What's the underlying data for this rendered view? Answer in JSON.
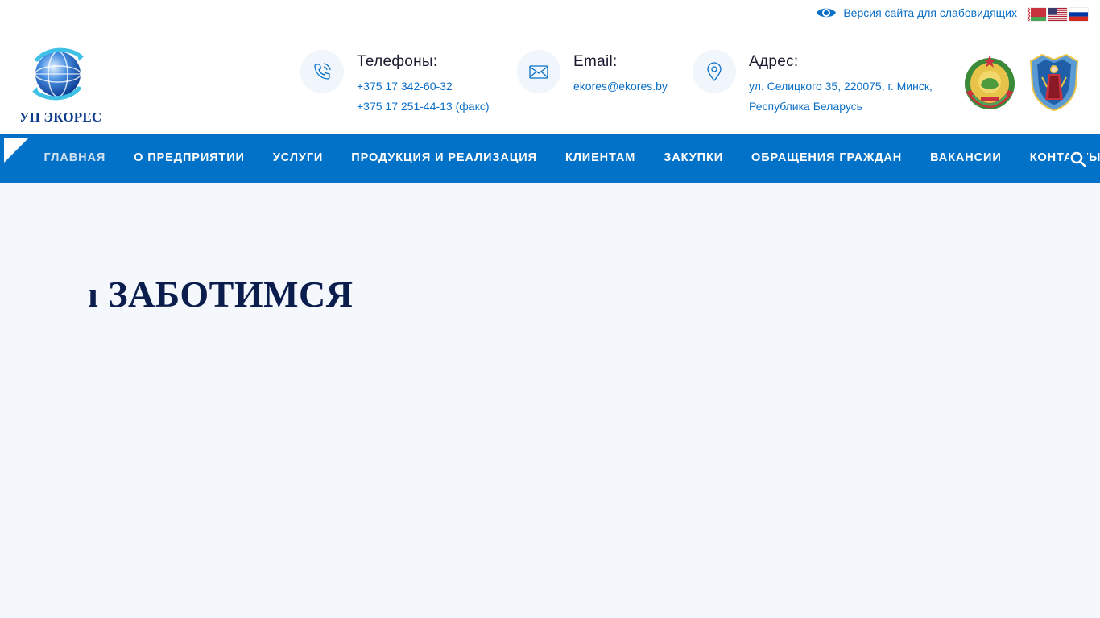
{
  "topbar": {
    "vision_link": "Версия сайта для слабовидящих",
    "vision_icon": "eye-icon",
    "languages": [
      {
        "code": "be",
        "icon": "flag-belarus-icon"
      },
      {
        "code": "en",
        "icon": "flag-usa-icon"
      },
      {
        "code": "ru",
        "icon": "flag-russia-icon"
      }
    ]
  },
  "header": {
    "logo_text": "УП ЭКОРЕС",
    "contacts": {
      "phone": {
        "label": "Телефоны:",
        "values": [
          "+375 17 342-60-32",
          "+375 17 251-44-13 (факс)"
        ],
        "icon": "phone-icon"
      },
      "email": {
        "label": "Email:",
        "value": "ekores@ekores.by",
        "icon": "envelope-icon"
      },
      "address": {
        "label": "Адрес:",
        "lines": [
          "ул. Селицкого 35, 220075, г. Минск,",
          "Республика Беларусь"
        ],
        "icon": "map-pin-icon"
      }
    },
    "emblems": [
      "belarus-coat-of-arms-icon",
      "minsk-coat-of-arms-icon"
    ]
  },
  "nav": {
    "items": [
      {
        "label": "ГЛАВНАЯ",
        "active": true
      },
      {
        "label": "О ПРЕДПРИЯТИИ"
      },
      {
        "label": "УСЛУГИ"
      },
      {
        "label": "ПРОДУКЦИЯ И РЕАЛИЗАЦИЯ"
      },
      {
        "label": "КЛИЕНТАМ"
      },
      {
        "label": "ЗАКУПКИ"
      },
      {
        "label": "ОБРАЩЕНИЯ ГРАЖДАН"
      },
      {
        "label": "ВАКАНСИИ"
      },
      {
        "label": "КОНТАКТЫ"
      }
    ],
    "search_icon": "search-icon"
  },
  "hero": {
    "title": "ı ЗАБОТИМСЯ"
  },
  "colors": {
    "brand_blue": "#0172c8",
    "link_blue": "#0a6fc7",
    "title_navy": "#0b1d4d",
    "hero_bg": "#f4f8fd"
  }
}
